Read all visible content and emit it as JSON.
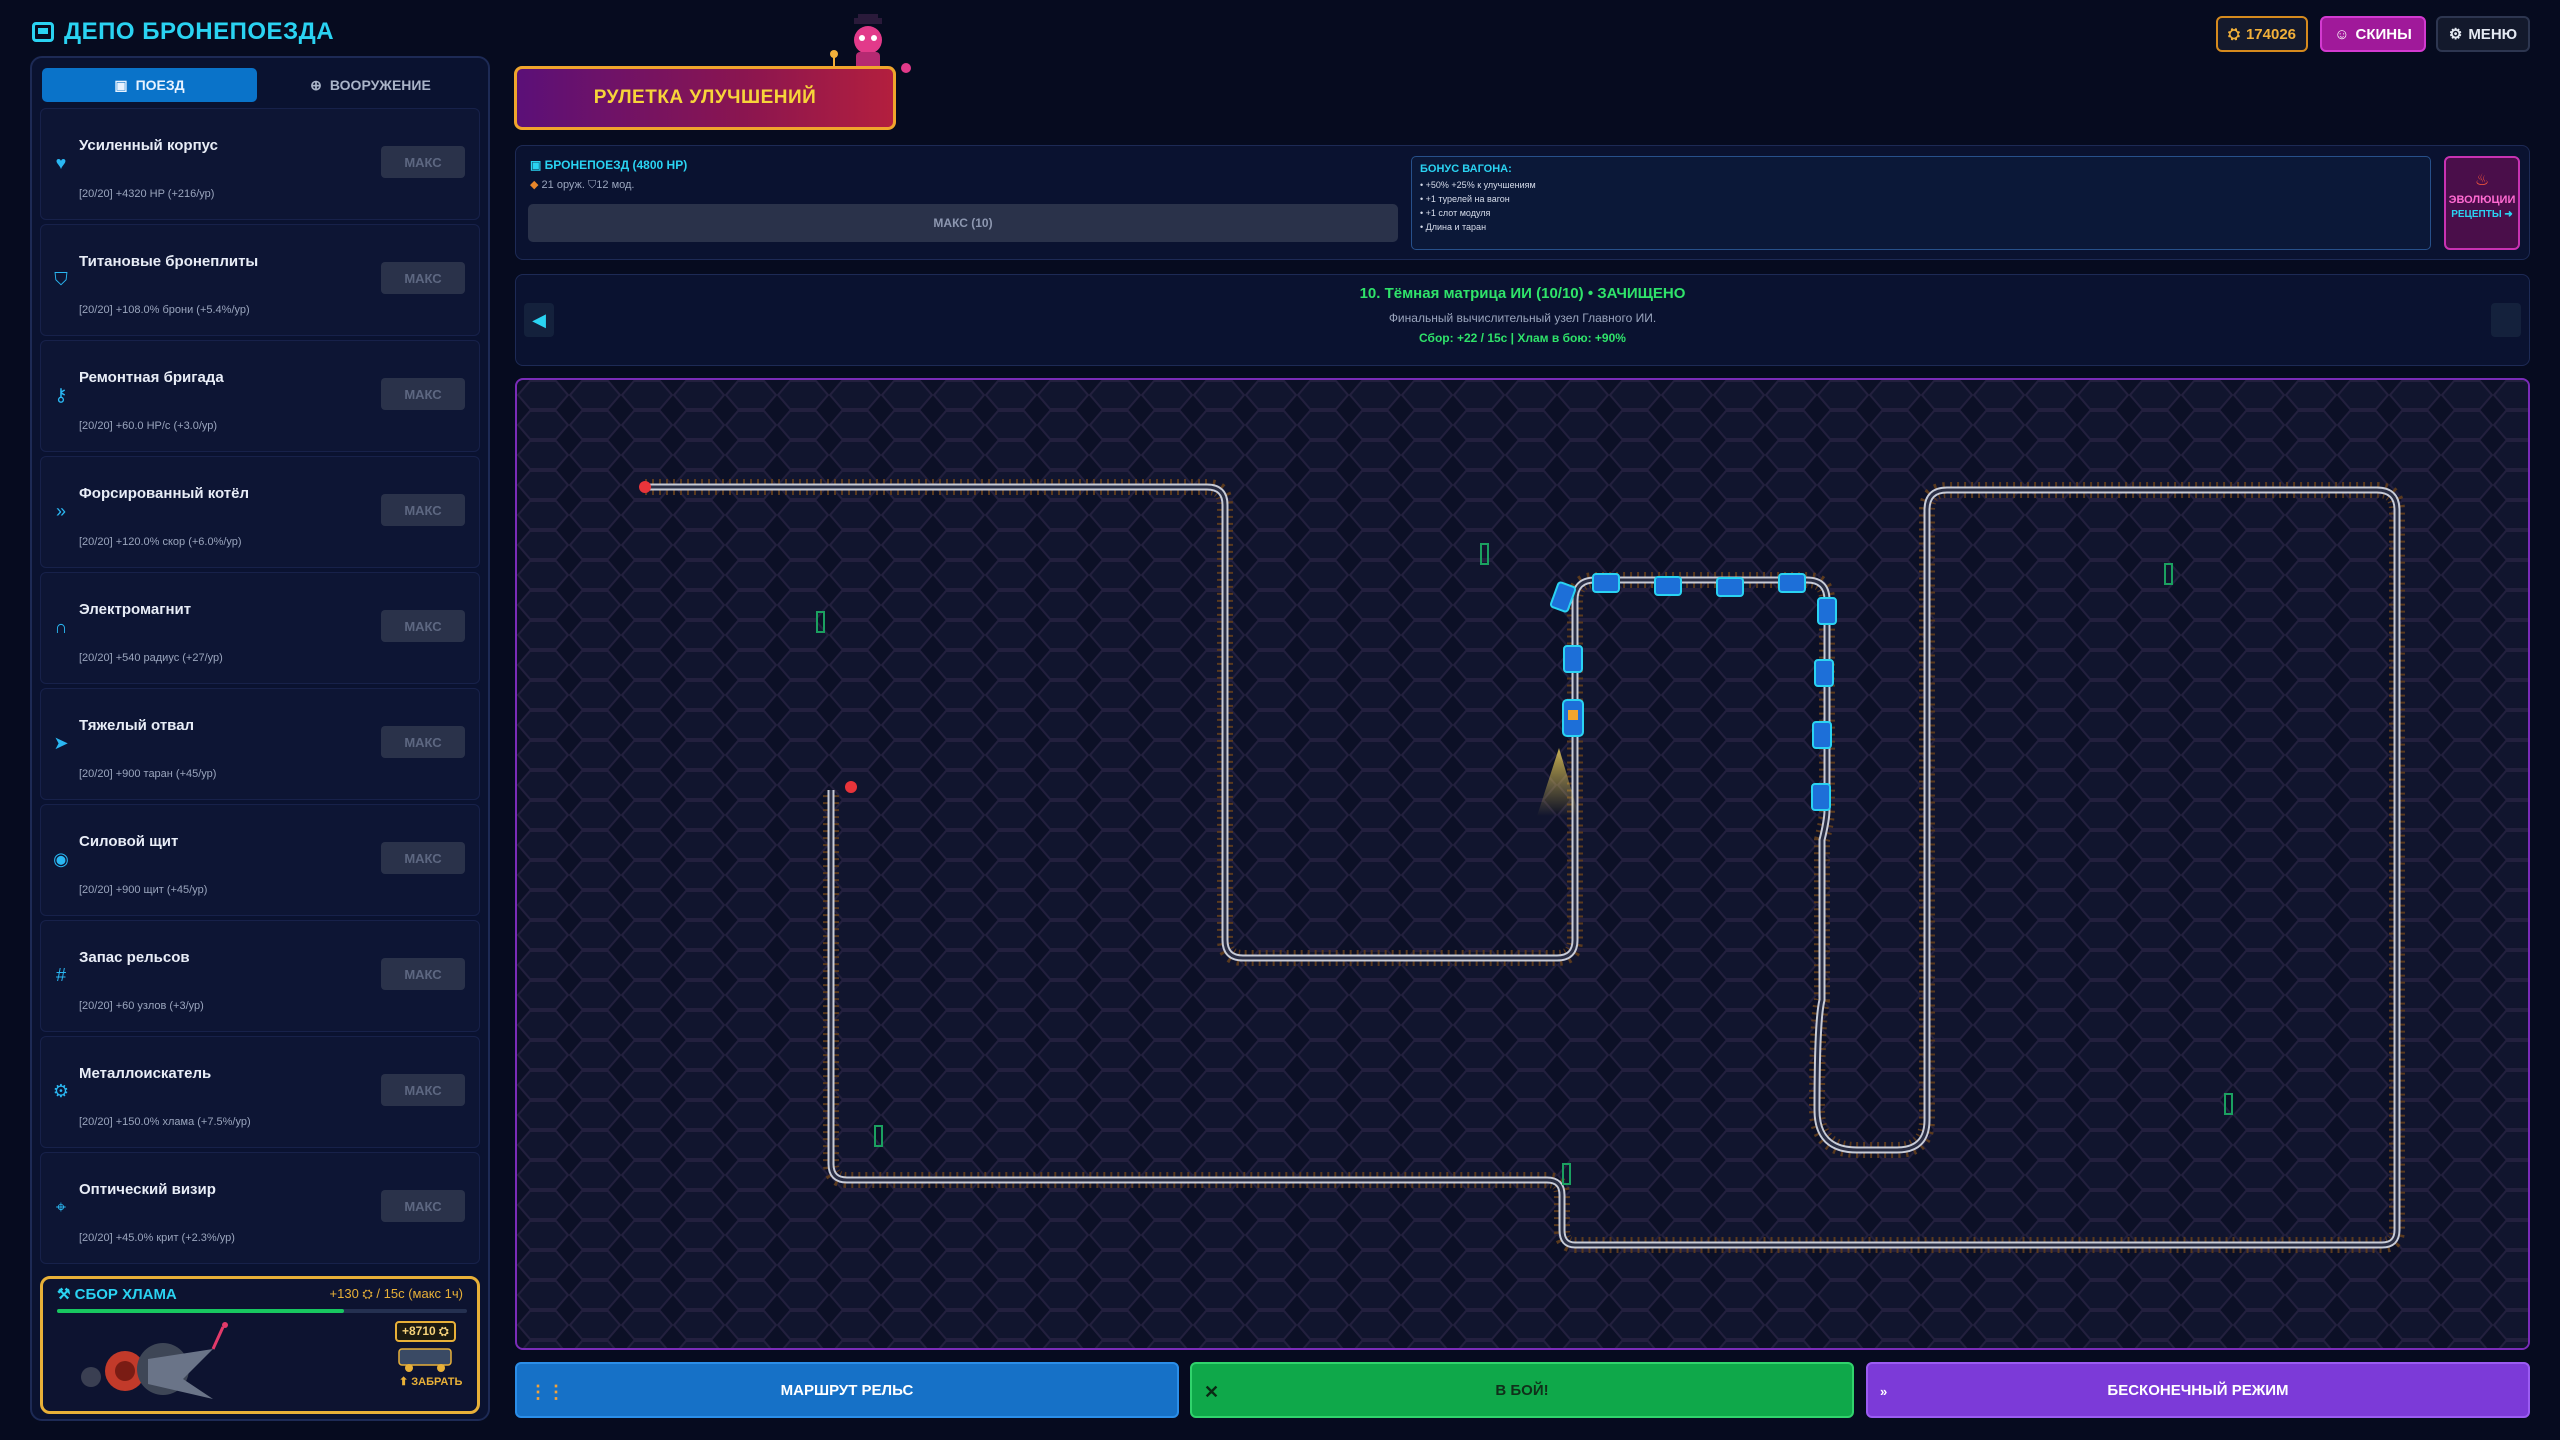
{
  "app": {
    "title": "ДЕПО БРОНЕПОЕЗДА"
  },
  "tabs": [
    {
      "label": "ПОЕЗД",
      "icon": "train-icon",
      "active": true
    },
    {
      "label": "ВООРУЖЕНИЕ",
      "icon": "crosshair-icon",
      "active": false
    }
  ],
  "upgrades": [
    {
      "name": "Усиленный корпус",
      "stat": "[20/20] +4320 HP (+216/ур)",
      "button": "МАКС",
      "icon": "shield-heart-icon",
      "glyph": "♥"
    },
    {
      "name": "Титановые бронеплиты",
      "stat": "[20/20] +108.0% брони (+5.4%/ур)",
      "button": "МАКС",
      "icon": "shield-icon",
      "glyph": "⛉"
    },
    {
      "name": "Ремонтная бригада",
      "stat": "[20/20] +60.0 HP/с (+3.0/ур)",
      "button": "МАКС",
      "icon": "wrench-icon",
      "glyph": "⚷"
    },
    {
      "name": "Форсированный котёл",
      "stat": "[20/20] +120.0% скор (+6.0%/ур)",
      "button": "МАКС",
      "icon": "speed-chevrons-icon",
      "glyph": "»"
    },
    {
      "name": "Электромагнит",
      "stat": "[20/20] +540 радиус (+27/ур)",
      "button": "МАКС",
      "icon": "magnet-icon",
      "glyph": "∩"
    },
    {
      "name": "Тяжелый отвал",
      "stat": "[20/20] +900 таран (+45/ур)",
      "button": "МАКС",
      "icon": "plow-arrow-icon",
      "glyph": "➤"
    },
    {
      "name": "Силовой щит",
      "stat": "[20/20] +900 щит (+45/ур)",
      "button": "МАКС",
      "icon": "force-shield-icon",
      "glyph": "◉"
    },
    {
      "name": "Запас рельсов",
      "stat": "[20/20] +60 узлов (+3/ур)",
      "button": "МАКС",
      "icon": "rails-icon",
      "glyph": "#"
    },
    {
      "name": "Металлоискатель",
      "stat": "[20/20] +150.0% хлама (+7.5%/ур)",
      "button": "МАКС",
      "icon": "gear-icon",
      "glyph": "⚙"
    },
    {
      "name": "Оптический визир",
      "stat": "[20/20] +45.0% крит (+2.3%/ур)",
      "button": "МАКС",
      "icon": "scope-icon",
      "glyph": "⌖"
    }
  ],
  "scrap": {
    "title": "СБОР ХЛАМА",
    "rate": "+130 ⛭ / 15с (макс 1ч)",
    "progress": 0.7,
    "badge": "+8710 ⛭",
    "claim": "⬆ ЗАБРАТЬ"
  },
  "top": {
    "coins": "174026",
    "skins": "СКИНЫ",
    "menu": "МЕНЮ"
  },
  "roulette": {
    "label": "РУЛЕТКА УЛУЧШЕНИЙ"
  },
  "train": {
    "name": "БРОНЕПОЕЗД (4800 HP)",
    "sub": "21 оруж. ⛉12 мод.",
    "max_label": "МАКС (10)",
    "bonus_title": "БОНУС ВАГОНА:",
    "bonus_lines": [
      "• +50% +25% к улучшениям",
      "• +1 турелей на вагон",
      "• +1 слот модуля",
      "• Длина и таран"
    ],
    "evo_label": "ЭВОЛЮЦИИ",
    "evo_recipes": "РЕЦЕПТЫ ➜"
  },
  "level": {
    "title": "10. Тёмная матрица ИИ (10/10) • ЗАЧИЩЕНО",
    "desc": "Финальный вычислительный узел Главного ИИ.",
    "stats": "Сбор: +22 / 15с | Хлам в бою: +90%"
  },
  "bottom": {
    "route": "МАРШРУТ РЕЛЬС",
    "fight": "В БОЙ!",
    "endless": "БЕСКОНЕЧНЫЙ РЕЖИМ"
  },
  "colors": {
    "accent": "#2ad3f2",
    "gold": "#e8b038",
    "green": "#18c760",
    "purple": "#7c3ad8",
    "map_border": "#7a2cb8"
  }
}
